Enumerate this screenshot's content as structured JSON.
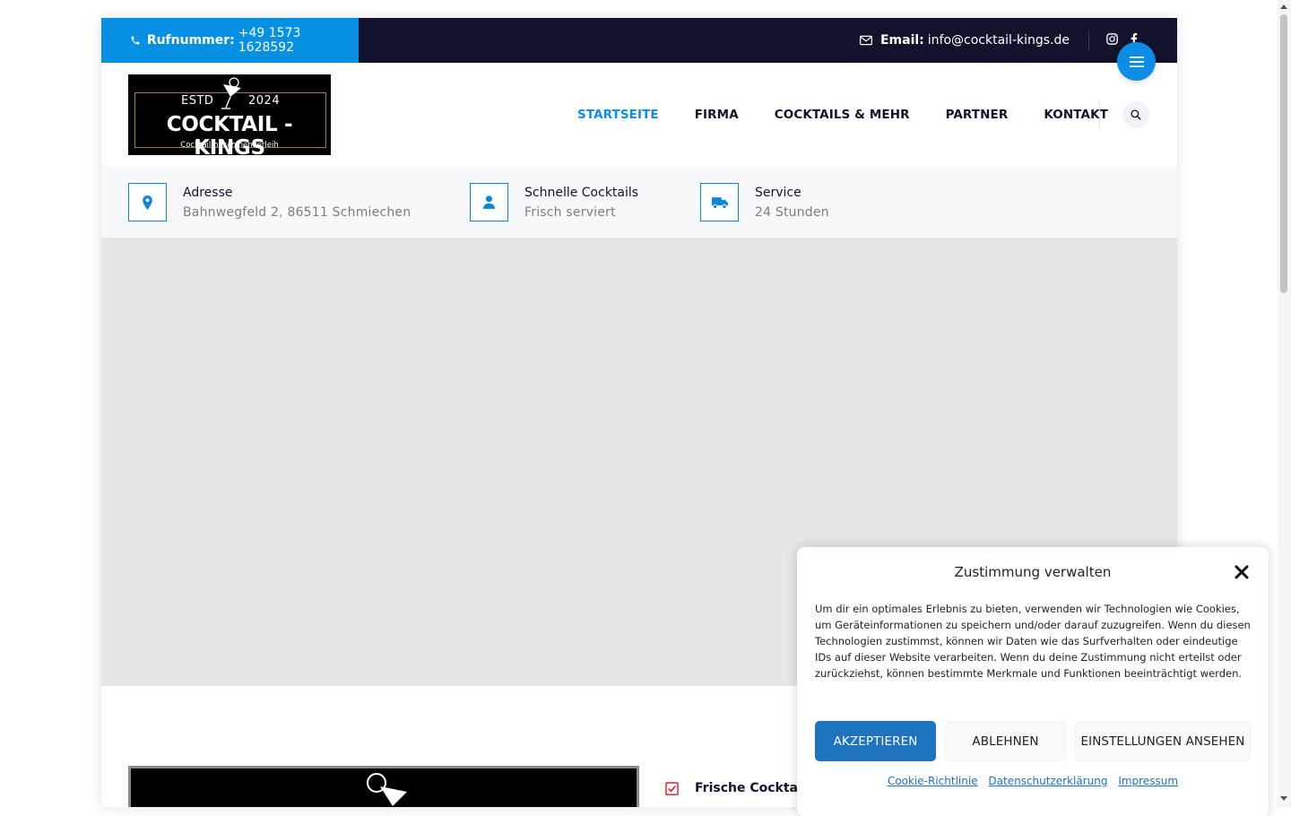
{
  "topbar": {
    "phone_label": "Rufnummer:",
    "phone_value": "+49 1573 1628592",
    "email_label": "Email:",
    "email_value": "info@cocktail-kings.de"
  },
  "logo": {
    "estd": "ESTD",
    "year": "2024",
    "brand": "COCKTAIL - KINGS",
    "subtitle": "Cocktailmaschinenverleih"
  },
  "nav": {
    "items": [
      "STARTSEITE",
      "FIRMA",
      "COCKTAILS & MEHR",
      "PARTNER",
      "KONTAKT"
    ],
    "active": "STARTSEITE"
  },
  "info": [
    {
      "title": "Adresse",
      "value": "Bahnwegfeld 2, 86511 Schmiechen",
      "icon": "map-pin-icon"
    },
    {
      "title": "Schnelle Cocktails",
      "value": "Frisch serviert",
      "icon": "user-icon"
    },
    {
      "title": "Service",
      "value": "24 Stunden",
      "icon": "truck-icon"
    }
  ],
  "features": {
    "first_label": "Frische Cocktails"
  },
  "cookie": {
    "title": "Zustimmung verwalten",
    "body": "Um dir ein optimales Erlebnis zu bieten, verwenden wir Technologien wie Cookies, um Geräteinformationen zu speichern und/oder darauf zuzugreifen. Wenn du diesen Technologien zustimmst, können wir Daten wie das Surfverhalten oder eindeutige IDs auf dieser Website verarbeiten. Wenn du deine Zustimmung nicht erteilst oder zurückziehst, können bestimmte Merkmale und Funktionen beeinträchtigt werden.",
    "accept": "AKZEPTIEREN",
    "deny": "ABLEHNEN",
    "preferences": "EINSTELLUNGEN ANSEHEN",
    "links": [
      "Cookie-Richtlinie",
      "Datenschutzerklärung",
      "Impressum"
    ]
  },
  "colors": {
    "accent": "#0590e3",
    "topbar": "#13132e",
    "cookie_accept": "#1e73be"
  }
}
